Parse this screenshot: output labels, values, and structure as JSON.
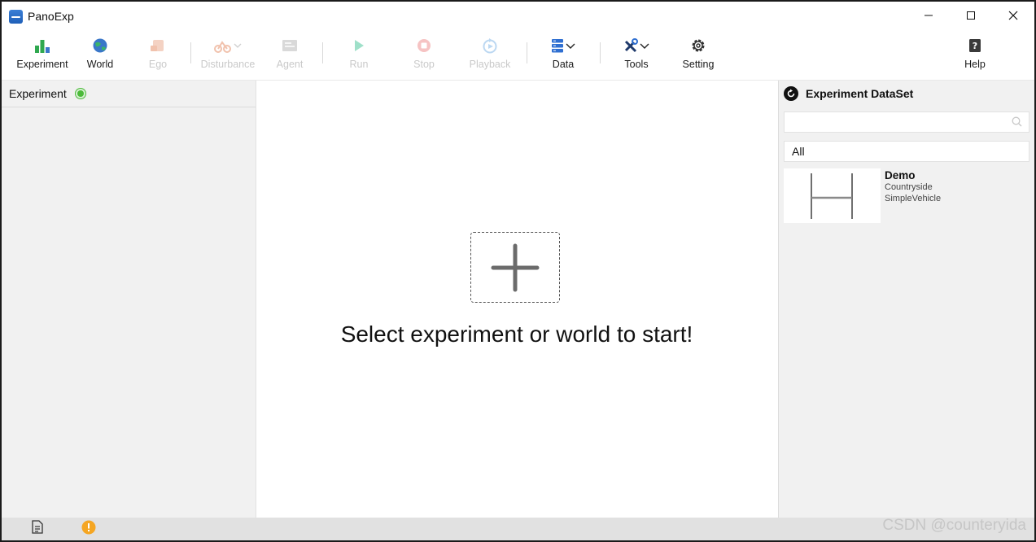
{
  "window": {
    "title": "PanoExp",
    "controls": {
      "minimize": "minimize",
      "maximize": "maximize",
      "close": "close"
    }
  },
  "toolbar": {
    "experiment": "Experiment",
    "world": "World",
    "ego": "Ego",
    "disturbance": "Disturbance",
    "agent": "Agent",
    "run": "Run",
    "stop": "Stop",
    "playback": "Playback",
    "data": "Data",
    "tools": "Tools",
    "setting": "Setting",
    "help": "Help"
  },
  "left_panel": {
    "title": "Experiment",
    "status": "connected"
  },
  "center": {
    "prompt": "Select experiment or world to start!"
  },
  "right_panel": {
    "title": "Experiment DataSet",
    "search": {
      "placeholder": "",
      "value": ""
    },
    "filter": "All",
    "items": [
      {
        "name": "Demo",
        "world": "Countryside",
        "vehicle": "SimpleVehicle"
      }
    ]
  },
  "statusbar": {
    "watermark": "CSDN @counteryida"
  },
  "colors": {
    "status_ok": "#4cba3a",
    "warning": "#f5a623",
    "accent": "#2f6fd1"
  }
}
